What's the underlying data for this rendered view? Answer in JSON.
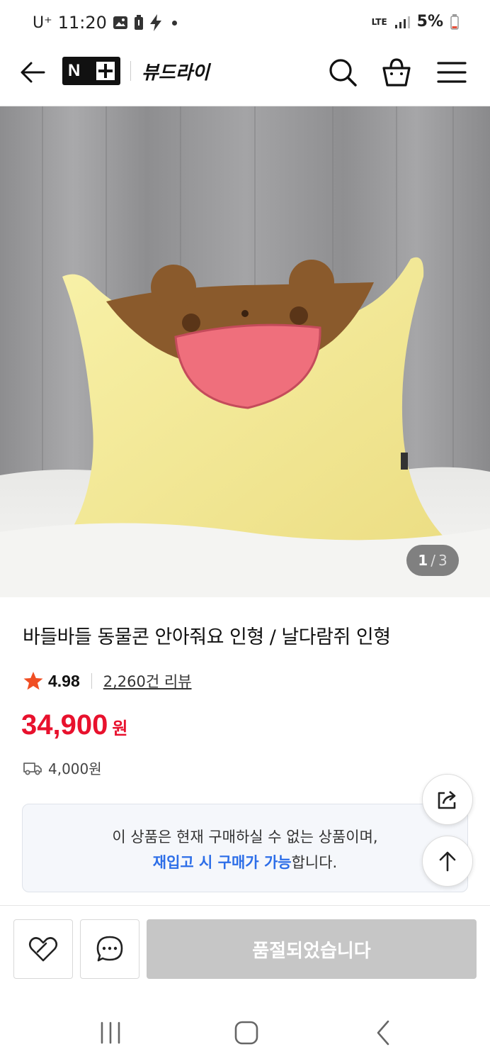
{
  "status_bar": {
    "carrier": "U⁺",
    "time": "11:20",
    "network": "LTE",
    "battery": "5%"
  },
  "header": {
    "logo_text": "N",
    "store_name": "뷰드라이",
    "icons": [
      "back-arrow-icon",
      "search-icon",
      "shopping-bag-icon",
      "hamburger-menu-icon"
    ]
  },
  "product": {
    "image_counter": {
      "current": "1",
      "separator": "/",
      "total": "3"
    },
    "title": "바들바들 동물콘 안아줘요 인형 / 날다람쥐 인형",
    "rating": "4.98",
    "review_link": "2,260건 리뷰",
    "price": "34,900",
    "price_unit": "원",
    "shipping_fee": "4,000원"
  },
  "notice": {
    "line1": "이 상품은 현재 구매하실 수 없는 상품이며,",
    "line2_highlight": "재입고 시 구매가 가능",
    "line2_rest": "합니다."
  },
  "bottom_bar": {
    "soldout_label": "품절되었습니다"
  },
  "colors": {
    "price_red": "#e8112d",
    "notice_blue": "#2d6ee8",
    "star": "#f04e23",
    "soldout_gray": "#c6c6c6"
  }
}
